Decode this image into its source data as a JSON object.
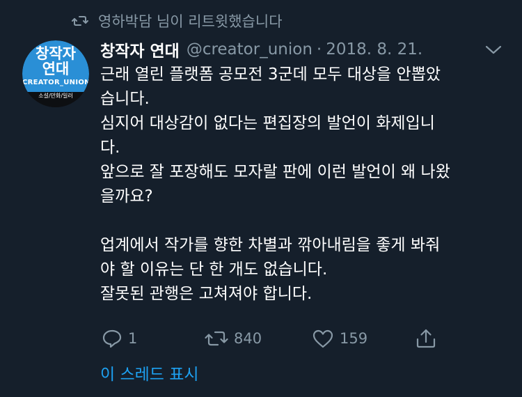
{
  "context": {
    "retweet_text": "영하박담 님이 리트윗했습니다",
    "icon": "retweet-icon"
  },
  "avatar": {
    "title_line1": "창작자",
    "title_line2": "연대",
    "brand": "CREATOR_UNION",
    "sub": "소설/만화/일러"
  },
  "tweet": {
    "display_name": "창작자 연대",
    "handle": "@creator_union",
    "separator": "·",
    "date": "2018. 8. 21.",
    "lines": [
      "근래 열린 플랫폼 공모전 3군데 모두 대상을 안뽑았",
      "습니다.",
      "심지어 대상감이 없다는 편집장의 발언이 화제입니",
      "다.",
      "앞으로 잘 포장해도 모자랄 판에 이런 발언이 왜 나왔",
      "을까요?",
      "",
      "업계에서 작가를 향한 차별과 깎아내림을 좋게 봐줘",
      "야 할 이유는 단 한 개도 없습니다.",
      "잘못된 관행은 고쳐져야 합니다."
    ]
  },
  "actions": {
    "reply_count": "1",
    "retweet_count": "840",
    "like_count": "159",
    "icons": [
      "reply-icon",
      "retweet-icon",
      "like-icon",
      "share-icon"
    ]
  },
  "show_thread": "이 스레드 표시",
  "colors": {
    "background": "#151f2b",
    "secondary_text": "#8899a6",
    "link": "#1da1f2",
    "avatar_blue": "#2a8fd6"
  }
}
